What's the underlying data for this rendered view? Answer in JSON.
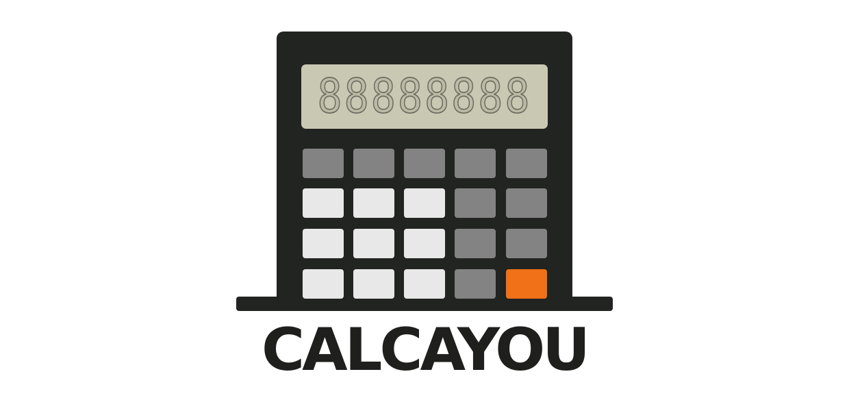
{
  "logo": {
    "display_text": "88888888",
    "brand_name": "CALCAYOU",
    "keypad": {
      "rows": [
        [
          "dark",
          "dark",
          "dark",
          "dark",
          "dark"
        ],
        [
          "light",
          "light",
          "light",
          "dark",
          "dark"
        ],
        [
          "light",
          "light",
          "light",
          "dark",
          "dark"
        ],
        [
          "light",
          "light",
          "light",
          "dark",
          "orange"
        ]
      ]
    },
    "colors": {
      "body": "#222421",
      "display": "#c9c8b2",
      "key_dark": "#838383",
      "key_light": "#e8e8e8",
      "key_accent": "#f07118",
      "brand_text": "#1f1f1d"
    }
  }
}
